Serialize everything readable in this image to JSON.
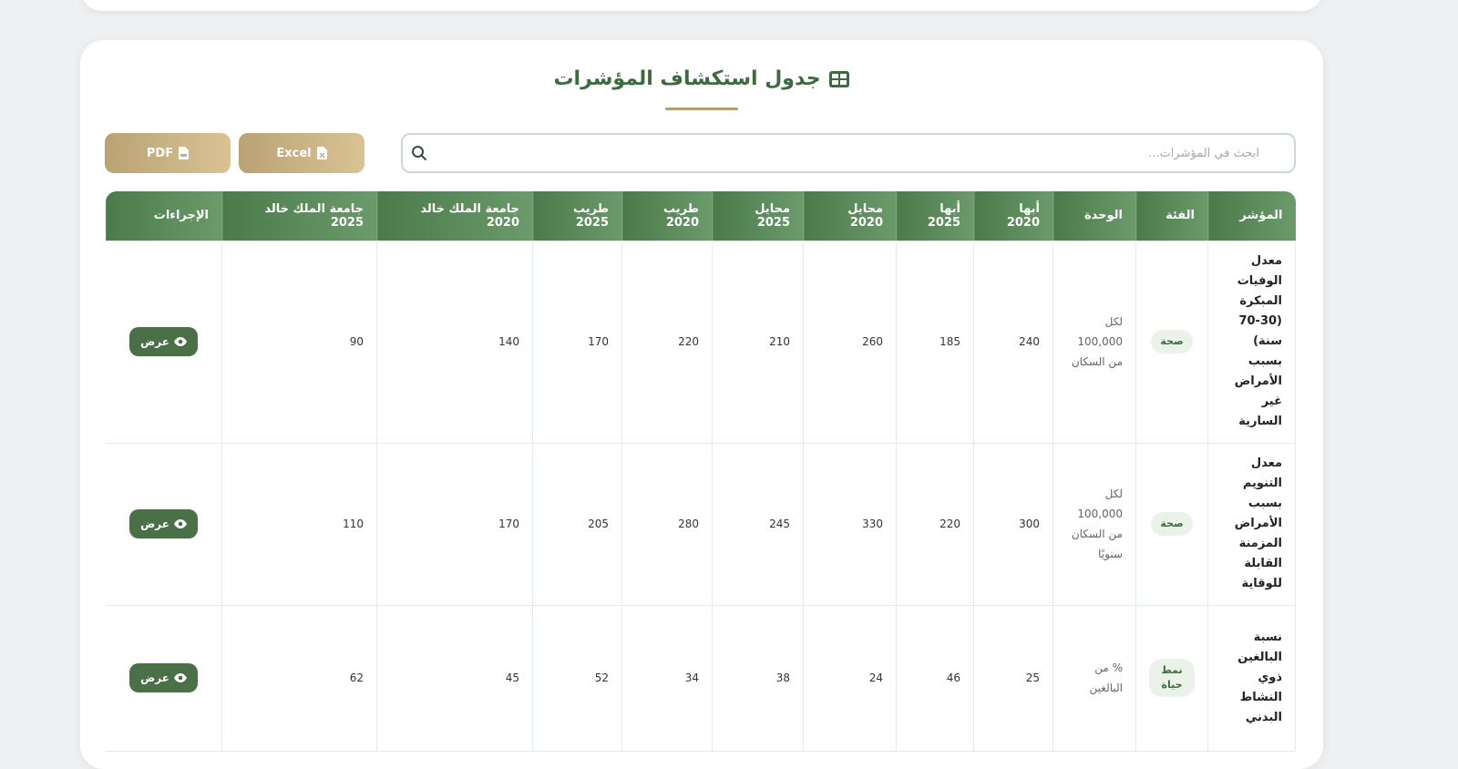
{
  "page": {
    "title": "جدول استكشاف المؤشرات"
  },
  "search": {
    "placeholder": "ابحث في المؤشرات..."
  },
  "export": {
    "excel_label": "Excel",
    "pdf_label": "PDF"
  },
  "table": {
    "headers": {
      "indicator": "المؤشر",
      "category": "الفئة",
      "unit": "الوحدة",
      "abha_2020": "أبها 2020",
      "abha_2025": "أبها 2025",
      "mahayel_2020": "محايل 2020",
      "mahayel_2025": "محايل 2025",
      "tareeb_2020": "طريب 2020",
      "tareeb_2025": "طريب 2025",
      "kku_2020": "جامعة الملك خالد 2020",
      "kku_2025": "جامعة الملك خالد 2025",
      "actions": "الإجراءات"
    },
    "rows": [
      {
        "indicator": "معدل الوفيات المبكرة (30-70 سنة) بسبب الأمراض غير السارية",
        "category": "صحة",
        "unit": "لكل 100,000 من السكان",
        "abha_2020": "240",
        "abha_2025": "185",
        "mahayel_2020": "260",
        "mahayel_2025": "210",
        "tareeb_2020": "220",
        "tareeb_2025": "170",
        "kku_2020": "140",
        "kku_2025": "90",
        "action": "عرض"
      },
      {
        "indicator": "معدل التنويم بسبب الأمراض المزمنة القابلة للوقاية",
        "category": "صحة",
        "unit": "لكل 100,000 من السكان سنويًا",
        "abha_2020": "300",
        "abha_2025": "220",
        "mahayel_2020": "330",
        "mahayel_2025": "245",
        "tareeb_2020": "280",
        "tareeb_2025": "205",
        "kku_2020": "170",
        "kku_2025": "110",
        "action": "عرض"
      },
      {
        "indicator": "نسبة البالغين ذوي النشاط البدني",
        "category": "نمط حياة",
        "unit": "% من البالغين",
        "abha_2020": "25",
        "abha_2025": "46",
        "mahayel_2020": "24",
        "mahayel_2025": "38",
        "tareeb_2020": "34",
        "tareeb_2025": "52",
        "kku_2020": "45",
        "kku_2025": "62",
        "action": "عرض"
      }
    ]
  },
  "colors": {
    "primary_green": "#4b7a4b",
    "accent_gold": "#c9b284",
    "badge_bg": "#eaf2ea"
  }
}
